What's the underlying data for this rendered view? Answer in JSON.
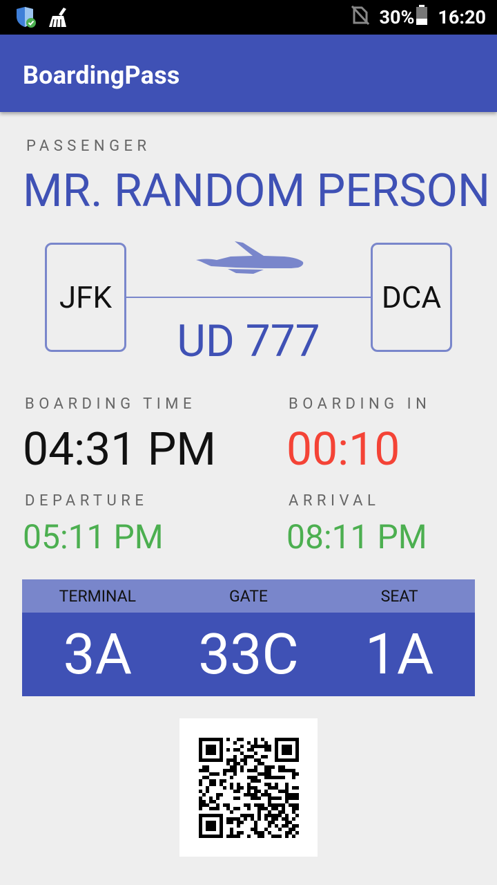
{
  "status_bar": {
    "battery": "30%",
    "time": "16:20",
    "icons": [
      "shield-check-icon",
      "cleaner-broom-icon",
      "no-sim-icon",
      "battery-icon"
    ]
  },
  "app": {
    "title": "BoardingPass"
  },
  "passenger": {
    "label": "PASSENGER",
    "name": "MR. RANDOM PERSON"
  },
  "flight": {
    "origin": "JFK",
    "destination": "DCA",
    "number": "UD 777",
    "icon": "airplane-icon"
  },
  "times": {
    "boarding_time_label": "BOARDING TIME",
    "boarding_time": "04:31 PM",
    "boarding_in_label": "BOARDING IN",
    "boarding_in": "00:10",
    "departure_label": "DEPARTURE",
    "departure": "05:11 PM",
    "arrival_label": "ARRIVAL",
    "arrival": "08:11 PM"
  },
  "details": {
    "terminal_label": "TERMINAL",
    "terminal": "3A",
    "gate_label": "GATE",
    "gate": "33C",
    "seat_label": "SEAT",
    "seat": "1A"
  },
  "qr": {
    "icon": "qr-code"
  },
  "colors": {
    "primary": "#3f51b5",
    "primary_light": "#7986cb",
    "alert_red": "#f44336",
    "green": "#4caf50",
    "background": "#eeeeee"
  }
}
